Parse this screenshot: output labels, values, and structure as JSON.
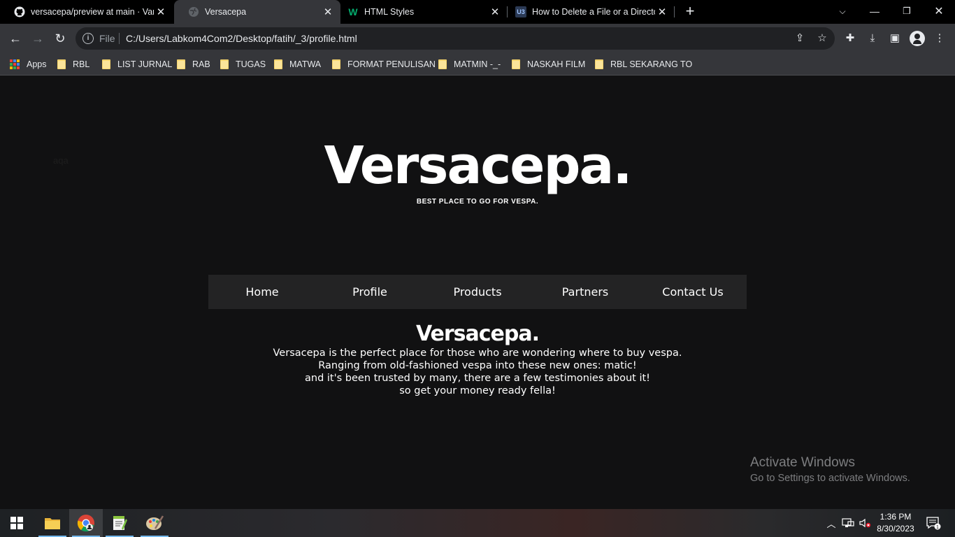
{
  "tabs": [
    {
      "title": "versacepa/preview at main · Varm",
      "favicon": "github-icon",
      "active": false
    },
    {
      "title": "Versacepa",
      "favicon": "globe-icon",
      "active": true
    },
    {
      "title": "HTML Styles",
      "favicon": "w3schools-icon",
      "active": false
    },
    {
      "title": "How to Delete a File or a Directo",
      "favicon": "u3-icon",
      "active": false
    }
  ],
  "omnibox": {
    "scheme_label": "File",
    "url": "C:/Users/Labkom4Com2/Desktop/fatih/_3/profile.html"
  },
  "bookmarks": {
    "apps_label": "Apps",
    "items": [
      "RBL",
      "LIST JURNAL",
      "RAB",
      "TUGAS",
      "MATWA",
      "FORMAT PENULISAN",
      "MATMIN -_-",
      "NASKAH FILM",
      "RBL SEKARANG TO"
    ]
  },
  "page": {
    "stray_text": "aqa",
    "brand": "Versacepa.",
    "tagline": "BEST PLACE TO GO FOR VESPA.",
    "nav": [
      "Home",
      "Profile",
      "Products",
      "Partners",
      "Contact Us"
    ],
    "content": {
      "title": "Versacepa.",
      "lines": [
        "Versacepa is the perfect place for those who are wondering where to buy vespa.",
        "Ranging from old-fashioned vespa into these new ones: matic!",
        "and it's been trusted by many, there are a few testimonies about it!",
        "so get your money ready fella!"
      ]
    }
  },
  "watermark": {
    "title": "Activate Windows",
    "subtitle": "Go to Settings to activate Windows."
  },
  "taskbar": {
    "time": "1:36 PM",
    "date": "8/30/2023",
    "notification_count": "1"
  },
  "colors": {
    "page_bg": "#111112",
    "nav_bg": "#232324",
    "toolbar_bg": "#35363a",
    "tabstrip_bg": "#000000"
  }
}
